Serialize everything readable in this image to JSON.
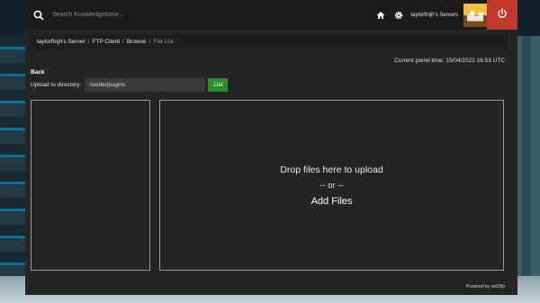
{
  "search": {
    "placeholder": "Search Knowledgebase..."
  },
  "nav": {
    "servers_label": "taylorftnjh's Servers",
    "icons": [
      "home-icon",
      "gear-icon",
      "power-icon"
    ]
  },
  "breadcrumb": {
    "items": [
      "taylorftnjh's Server",
      "FTP Client",
      "Browse"
    ],
    "active": "File List",
    "separator": "/"
  },
  "panel_time": "Current panel time: 15/04/2022 16:53 UTC",
  "back_label": "Back",
  "upload": {
    "label": "Upload to directory:",
    "directory_value": "/oxide/plugins",
    "list_button": "List"
  },
  "dropzone": {
    "drop_text": "Drop files here to upload",
    "or_text": "-- or --",
    "add_files_label": "Add Files"
  },
  "footer": {
    "powered_by": "Powered by net2ftp"
  },
  "colors": {
    "topbar": "#1b1b1b",
    "panel": "#252525",
    "list_button": "#2c8f2c",
    "logout_button": "#c0392b"
  }
}
